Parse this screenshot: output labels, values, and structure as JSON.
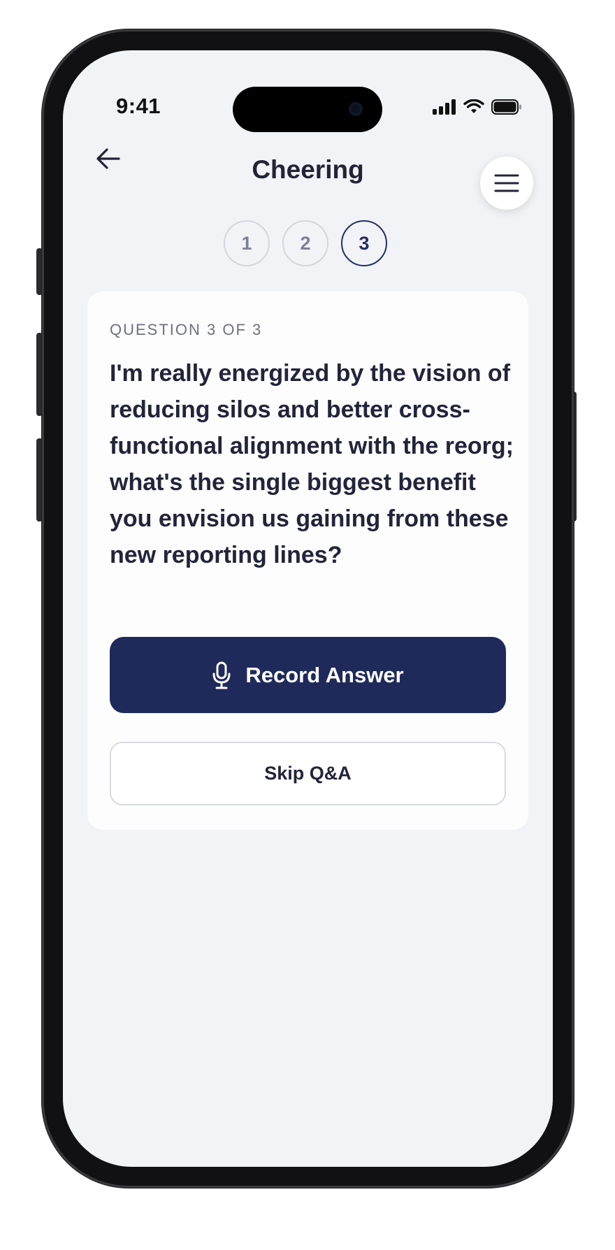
{
  "status_bar": {
    "time": "9:41"
  },
  "header": {
    "title": "Cheering"
  },
  "steps": [
    "1",
    "2",
    "3"
  ],
  "active_step": 3,
  "question": {
    "label": "QUESTION 3 OF 3",
    "text": "I'm really energized by the vision of reducing silos and better cross-functional alignment with the reorg; what's the single biggest benefit you envision us gaining from these new reporting lines?"
  },
  "actions": {
    "record_label": "Record Answer",
    "skip_label": "Skip Q&A"
  },
  "colors": {
    "primary": "#1f2a5b",
    "background": "#f2f3f7",
    "text": "#22243a"
  }
}
